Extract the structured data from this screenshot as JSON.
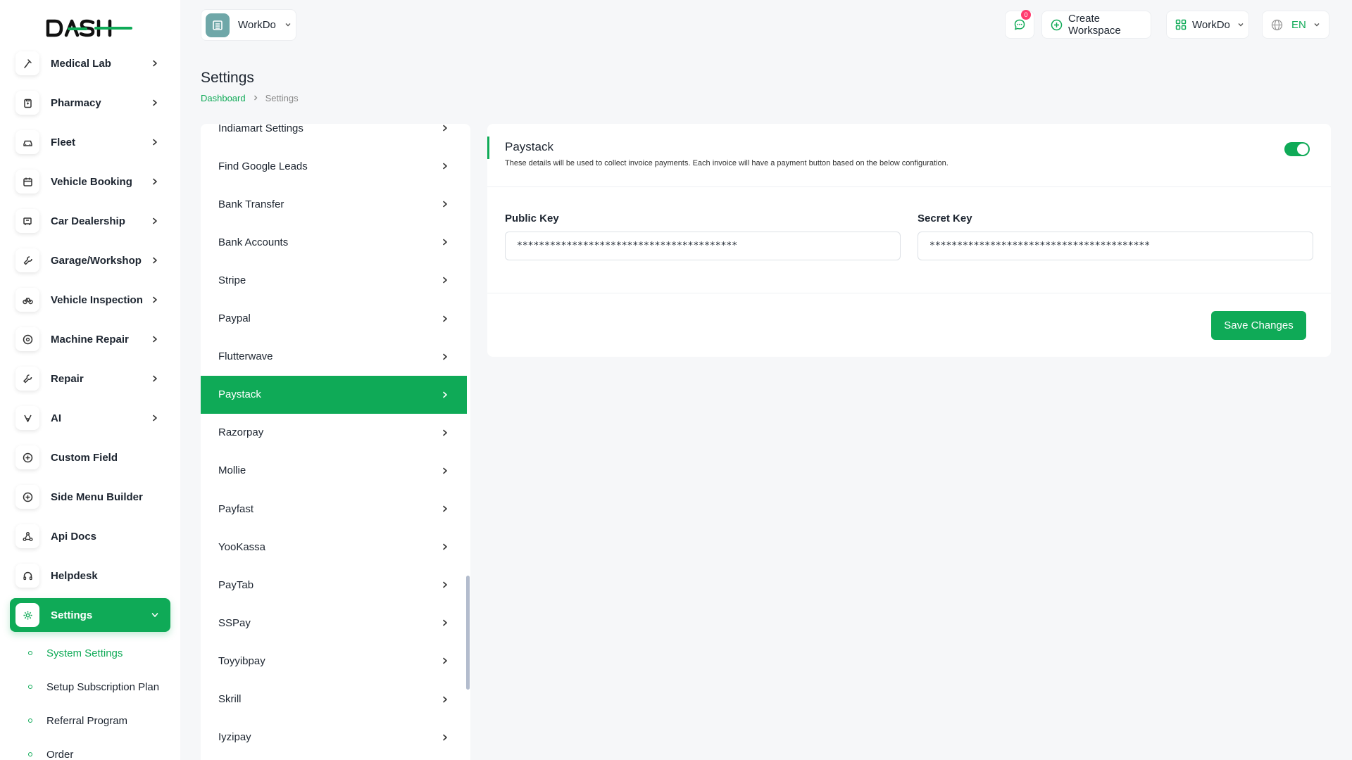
{
  "app": {
    "logo_text": "DASH",
    "brand_color": "#0faa57"
  },
  "sidebar": {
    "items": [
      {
        "label": "Medical Lab",
        "icon": "flask-icon",
        "has_children": true
      },
      {
        "label": "Pharmacy",
        "icon": "clipboard-icon",
        "has_children": true
      },
      {
        "label": "Fleet",
        "icon": "car-icon",
        "has_children": true
      },
      {
        "label": "Vehicle Booking",
        "icon": "calendar-icon",
        "has_children": true
      },
      {
        "label": "Car Dealership",
        "icon": "dealership-icon",
        "has_children": true
      },
      {
        "label": "Garage/Workshop",
        "icon": "wrench-icon",
        "has_children": true
      },
      {
        "label": "Vehicle Inspection",
        "icon": "bike-icon",
        "has_children": true
      },
      {
        "label": "Machine Repair",
        "icon": "settings-circle-icon",
        "has_children": true
      },
      {
        "label": "Repair",
        "icon": "tool-icon",
        "has_children": true
      },
      {
        "label": "AI",
        "icon": "ai-icon",
        "has_children": true
      },
      {
        "label": "Custom Field",
        "icon": "plus-circle-icon",
        "has_children": false
      },
      {
        "label": "Side Menu Builder",
        "icon": "plus-circle-icon",
        "has_children": false
      },
      {
        "label": "Api Docs",
        "icon": "webhook-icon",
        "has_children": false
      },
      {
        "label": "Helpdesk",
        "icon": "headset-icon",
        "has_children": false
      },
      {
        "label": "Settings",
        "icon": "gear-icon",
        "has_children": true,
        "active": true
      }
    ],
    "submenu": [
      {
        "label": "System Settings",
        "active": true
      },
      {
        "label": "Setup Subscription Plan"
      },
      {
        "label": "Referral Program"
      },
      {
        "label": "Order"
      }
    ]
  },
  "header": {
    "workspace": "WorkDo",
    "notification_count": "0",
    "create_workspace": "Create Workspace",
    "workdo_menu": "WorkDo",
    "language": "EN"
  },
  "page": {
    "title": "Settings",
    "breadcrumb": {
      "home": "Dashboard",
      "current": "Settings"
    }
  },
  "settings_list": [
    "Indiamart Settings",
    "Find Google Leads",
    "Bank Transfer",
    "Bank Accounts",
    "Stripe",
    "Paypal",
    "Flutterwave",
    "Paystack",
    "Razorpay",
    "Mollie",
    "Payfast",
    "YooKassa",
    "PayTab",
    "SSPay",
    "Toyyibpay",
    "Skrill",
    "Iyzipay"
  ],
  "settings_list_active": "Paystack",
  "paystack": {
    "title": "Paystack",
    "description": "These details will be used to collect invoice payments. Each invoice will have a payment button based on the below configuration.",
    "enabled": true,
    "public_key_label": "Public Key",
    "public_key_value": "****************************************",
    "secret_key_label": "Secret Key",
    "secret_key_value": "****************************************",
    "save_label": "Save Changes"
  }
}
